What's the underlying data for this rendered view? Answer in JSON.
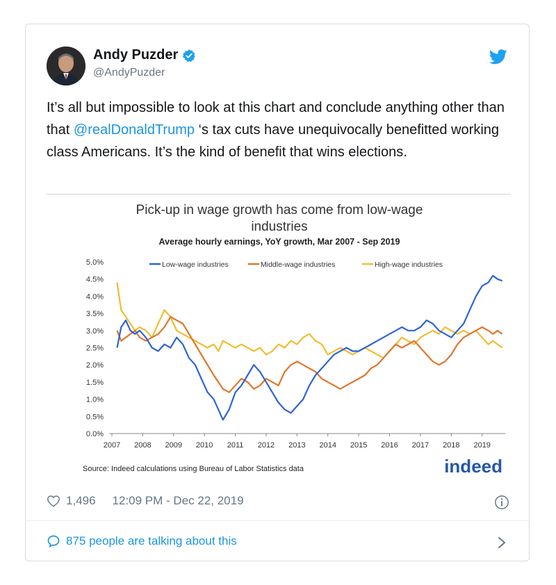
{
  "tweet": {
    "author_name": "Andy Puzder",
    "handle": "@AndyPuzder",
    "text_before": "It’s all but impossible to look at this chart and conclude anything other than that ",
    "mention": "@realDonaldTrump",
    "text_after": " ‘s tax cuts have unequivocally benefitted working class Americans. It’s the kind of benefit that wins elections.",
    "likes": "1,496",
    "timestamp": "12:09 PM - Dec 22, 2019",
    "talking": "875 people are talking about this"
  },
  "icons": {
    "avatar": "avatar",
    "verified": "verified-badge-icon",
    "bird": "twitter-bird-icon",
    "heart": "heart-icon",
    "info": "info-icon",
    "speech": "speech-bubble-icon",
    "chevron": "chevron-right-icon"
  },
  "colors": {
    "link": "#1b95e0",
    "low": "#2e63d6",
    "middle": "#e2752a",
    "high": "#f1bd2e"
  },
  "chart_data": {
    "type": "line",
    "title": "Pick-up in wage growth has come from low-wage industries",
    "subtitle": "Average hourly earnings, YoY growth, Mar 2007 - Sep 2019",
    "source": "Source: Indeed calculations using Bureau of Labor Statistics data",
    "brand": "indeed",
    "y_ticks": [
      "5.0%",
      "4.5%",
      "4.0%",
      "3.5%",
      "3.0%",
      "2.5%",
      "2.0%",
      "1.5%",
      "1.0%",
      "0.5%",
      "0.0%"
    ],
    "x_ticks": [
      "2007",
      "2008",
      "2009",
      "2010",
      "2011",
      "2012",
      "2013",
      "2014",
      "2015",
      "2016",
      "2017",
      "2018",
      "2019"
    ],
    "xlim": [
      2007.0,
      2019.75
    ],
    "ylim": [
      0,
      5.0
    ],
    "legend_placement": "top",
    "series": [
      {
        "name": "Low-wage industries",
        "x": [
          2007.17,
          2007.3,
          2007.45,
          2007.6,
          2007.75,
          2007.9,
          2008.1,
          2008.3,
          2008.5,
          2008.7,
          2008.9,
          2009.1,
          2009.3,
          2009.5,
          2009.7,
          2009.9,
          2010.1,
          2010.3,
          2010.45,
          2010.6,
          2010.8,
          2011.0,
          2011.2,
          2011.4,
          2011.6,
          2011.8,
          2012.0,
          2012.2,
          2012.4,
          2012.6,
          2012.8,
          2013.0,
          2013.2,
          2013.4,
          2013.6,
          2013.8,
          2014.0,
          2014.2,
          2014.4,
          2014.6,
          2014.8,
          2015.0,
          2015.2,
          2015.4,
          2015.6,
          2015.8,
          2016.0,
          2016.2,
          2016.4,
          2016.6,
          2016.8,
          2017.0,
          2017.2,
          2017.4,
          2017.6,
          2017.8,
          2018.0,
          2018.2,
          2018.4,
          2018.6,
          2018.8,
          2019.0,
          2019.2,
          2019.35,
          2019.5,
          2019.65
        ],
        "values": [
          2.5,
          3.1,
          3.3,
          3.0,
          2.9,
          3.0,
          2.8,
          2.5,
          2.4,
          2.6,
          2.5,
          2.8,
          2.6,
          2.2,
          2.0,
          1.6,
          1.2,
          1.0,
          0.7,
          0.4,
          0.7,
          1.2,
          1.4,
          1.7,
          2.0,
          1.8,
          1.5,
          1.2,
          0.9,
          0.7,
          0.6,
          0.8,
          1.0,
          1.4,
          1.7,
          1.9,
          2.1,
          2.3,
          2.4,
          2.5,
          2.4,
          2.4,
          2.5,
          2.6,
          2.7,
          2.8,
          2.9,
          3.0,
          3.1,
          3.0,
          3.0,
          3.1,
          3.3,
          3.2,
          3.0,
          2.9,
          2.8,
          3.0,
          3.2,
          3.6,
          4.0,
          4.3,
          4.4,
          4.6,
          4.5,
          4.45
        ]
      },
      {
        "name": "Middle-wage industries",
        "x": [
          2007.17,
          2007.3,
          2007.45,
          2007.6,
          2007.75,
          2007.9,
          2008.1,
          2008.3,
          2008.5,
          2008.7,
          2008.9,
          2009.1,
          2009.3,
          2009.5,
          2009.7,
          2009.9,
          2010.1,
          2010.3,
          2010.45,
          2010.6,
          2010.8,
          2011.0,
          2011.2,
          2011.4,
          2011.6,
          2011.8,
          2012.0,
          2012.2,
          2012.4,
          2012.6,
          2012.8,
          2013.0,
          2013.2,
          2013.4,
          2013.6,
          2013.8,
          2014.0,
          2014.2,
          2014.4,
          2014.6,
          2014.8,
          2015.0,
          2015.2,
          2015.4,
          2015.6,
          2015.8,
          2016.0,
          2016.2,
          2016.4,
          2016.6,
          2016.8,
          2017.0,
          2017.2,
          2017.4,
          2017.6,
          2017.8,
          2018.0,
          2018.2,
          2018.4,
          2018.6,
          2018.8,
          2019.0,
          2019.2,
          2019.35,
          2019.5,
          2019.65
        ],
        "values": [
          3.0,
          2.7,
          2.8,
          2.9,
          3.0,
          2.8,
          2.7,
          2.8,
          2.9,
          3.1,
          3.4,
          3.3,
          3.2,
          2.9,
          2.6,
          2.3,
          2.0,
          1.7,
          1.5,
          1.3,
          1.2,
          1.4,
          1.6,
          1.5,
          1.3,
          1.4,
          1.6,
          1.5,
          1.4,
          1.8,
          2.0,
          2.1,
          2.0,
          1.9,
          1.8,
          1.6,
          1.5,
          1.4,
          1.3,
          1.4,
          1.5,
          1.6,
          1.7,
          1.9,
          2.0,
          2.2,
          2.4,
          2.6,
          2.5,
          2.6,
          2.7,
          2.5,
          2.3,
          2.1,
          2.0,
          2.1,
          2.3,
          2.6,
          2.8,
          2.9,
          3.0,
          3.1,
          3.0,
          2.9,
          3.0,
          2.9
        ]
      },
      {
        "name": "High-wage industries",
        "x": [
          2007.17,
          2007.3,
          2007.45,
          2007.6,
          2007.75,
          2007.9,
          2008.1,
          2008.3,
          2008.5,
          2008.7,
          2008.9,
          2009.1,
          2009.3,
          2009.5,
          2009.7,
          2009.9,
          2010.1,
          2010.3,
          2010.45,
          2010.6,
          2010.8,
          2011.0,
          2011.2,
          2011.4,
          2011.6,
          2011.8,
          2012.0,
          2012.2,
          2012.4,
          2012.6,
          2012.8,
          2013.0,
          2013.2,
          2013.4,
          2013.6,
          2013.8,
          2014.0,
          2014.2,
          2014.4,
          2014.6,
          2014.8,
          2015.0,
          2015.2,
          2015.4,
          2015.6,
          2015.8,
          2016.0,
          2016.2,
          2016.4,
          2016.6,
          2016.8,
          2017.0,
          2017.2,
          2017.4,
          2017.6,
          2017.8,
          2018.0,
          2018.2,
          2018.4,
          2018.6,
          2018.8,
          2019.0,
          2019.2,
          2019.35,
          2019.5,
          2019.65
        ],
        "values": [
          4.4,
          3.6,
          3.4,
          3.2,
          3.0,
          3.1,
          3.0,
          2.8,
          3.2,
          3.6,
          3.4,
          3.0,
          2.9,
          2.8,
          2.7,
          2.6,
          2.5,
          2.6,
          2.4,
          2.7,
          2.6,
          2.5,
          2.6,
          2.5,
          2.4,
          2.5,
          2.3,
          2.4,
          2.6,
          2.5,
          2.7,
          2.6,
          2.8,
          2.9,
          2.7,
          2.6,
          2.3,
          2.4,
          2.5,
          2.4,
          2.3,
          2.4,
          2.5,
          2.4,
          2.3,
          2.2,
          2.4,
          2.6,
          2.8,
          2.7,
          2.6,
          2.8,
          2.9,
          3.0,
          2.9,
          3.1,
          3.0,
          2.9,
          3.0,
          2.9,
          3.0,
          2.8,
          2.6,
          2.7,
          2.6,
          2.5
        ]
      }
    ]
  }
}
